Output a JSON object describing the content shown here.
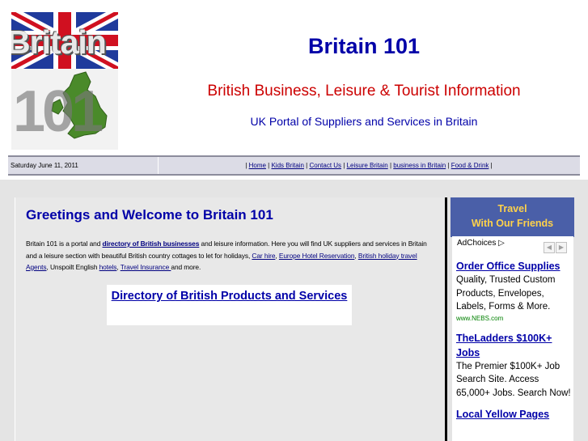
{
  "header": {
    "logo_word": "Britain",
    "logo_number": "101",
    "title": "Britain 101",
    "subtitle": "British Business, Leisure & Tourist Information",
    "tagline": "UK Portal of Suppliers and Services in Britain"
  },
  "nav": {
    "date": "Saturday June 11, 2011",
    "links": [
      "Home",
      "Kids Britain",
      "Contact Us",
      "Leisure Britain",
      "business in Britain",
      "Food & Drink"
    ]
  },
  "main": {
    "heading": "Greetings and Welcome to Britain 101",
    "intro": {
      "t1": "Britain 101 is a portal and ",
      "link1": "directory of British businesses",
      "t2": " and leisure information. Here you will find UK suppliers and services in Britain and a leisure section with beautiful British country cottages to let for holidays, ",
      "link2": "Car hire",
      "t3": ", ",
      "link3": "Europe Hotel Reservation",
      "t4": ", ",
      "link4": "British holiday travel Agents",
      "t5": ", Unspoilt English ",
      "link5": "hotels",
      "t6": ", ",
      "link6": "Travel Insurance ",
      "t7": "and more."
    },
    "directory_link": "Directory of British Products and Services"
  },
  "sidebar": {
    "heading_line1": "Travel",
    "heading_line2": "With Our Friends",
    "adchoices": "AdChoices",
    "ads": [
      {
        "title": "Order Office Supplies",
        "desc": "Quality, Trusted Custom Products, Envelopes, Labels, Forms & More.",
        "url": "www.NEBS.com"
      },
      {
        "title": "TheLadders $100K+ Jobs",
        "desc": "The Premier $100K+ Job Search Site. Access 65,000+ Jobs. Search Now!",
        "url": ""
      },
      {
        "title": "Local Yellow Pages",
        "desc": "",
        "url": ""
      }
    ]
  },
  "colors": {
    "title_blue": "#0000a8",
    "subtitle_red": "#cc0000",
    "travel_header_bg": "#4a5fa8",
    "travel_header_text": "#ffd24a"
  }
}
